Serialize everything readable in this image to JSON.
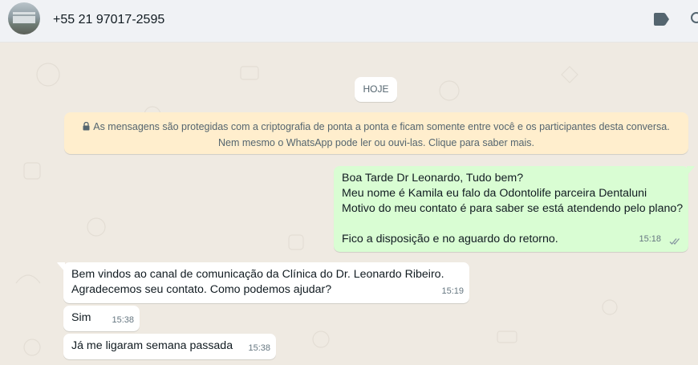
{
  "header": {
    "contact_name": "+55 21 97017-2595",
    "icons": [
      "avatar",
      "label-icon",
      "search-icon"
    ]
  },
  "chat": {
    "date_chip": "HOJE",
    "encryption_notice": {
      "line1": "As mensagens são protegidas com a criptografia de ponta a ponta e ficam somente entre você e os participantes desta conversa.",
      "line2": "Nem mesmo o WhatsApp pode ler ou ouvi-las. Clique para saber mais."
    },
    "messages": [
      {
        "direction": "outgoing",
        "lines": [
          "Boa Tarde Dr Leonardo, Tudo bem?",
          "Meu nome é Kamila eu falo da Odontolife parceira Dentaluni",
          "Motivo do meu contato é para saber se está atendendo pelo plano?",
          "",
          "Fico a disposição e no aguardo do retorno."
        ],
        "time": "15:18",
        "status": "read"
      },
      {
        "direction": "incoming",
        "lines": [
          "Bem vindos ao canal de comunicação da Clínica  do Dr. Leonardo Ribeiro.",
          "Agradecemos seu contato. Como podemos ajudar?"
        ],
        "time": "15:19"
      },
      {
        "direction": "incoming",
        "lines": [
          "Sim"
        ],
        "time": "15:38"
      },
      {
        "direction": "incoming",
        "lines": [
          "Já me ligaram semana passada"
        ],
        "time": "15:38"
      }
    ]
  },
  "colors": {
    "header_bg": "#f0f2f5",
    "chat_bg": "#efeae2",
    "outgoing_bubble": "#d9fdd3",
    "incoming_bubble": "#ffffff",
    "encryption_bg": "#ffeecd",
    "read_ticks": "#8696a0"
  }
}
